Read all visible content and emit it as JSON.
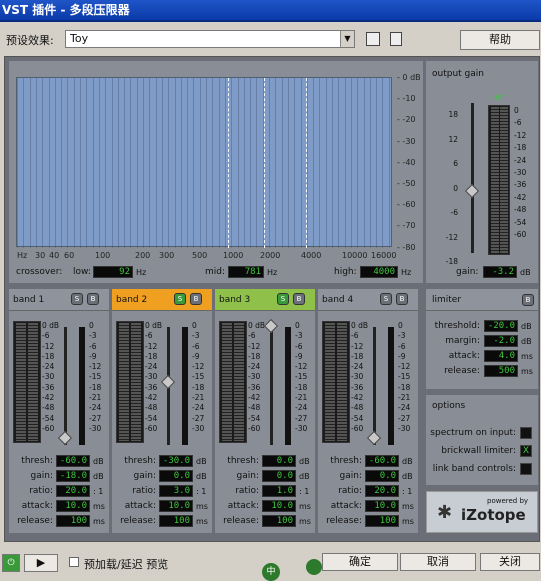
{
  "window": {
    "title": "VST 插件 - 多段压限器"
  },
  "toolbar": {
    "preset_label": "预设效果:",
    "preset_value": "Toy",
    "help_label": "帮助"
  },
  "graph": {
    "db_labels": [
      "0 dB",
      "-10",
      "-20",
      "-30",
      "-40",
      "-50",
      "-60",
      "-70",
      "-80"
    ],
    "hz_labels": [
      "Hz",
      "30",
      "40",
      "60",
      "100",
      "200",
      "300",
      "500",
      "1000",
      "2000",
      "4000",
      "10000",
      "16000"
    ],
    "crossover_label": "crossover:",
    "low_label": "low:",
    "low_value": "92",
    "mid_label": "mid:",
    "mid_value": "781",
    "high_label": "high:",
    "high_value": "4000",
    "unit": "Hz"
  },
  "output_gain": {
    "title": "output gain",
    "scale_left": [
      "18",
      "12",
      "6",
      "0",
      "-6",
      "-12",
      "-18"
    ],
    "peak": "-Inf",
    "scale_right": [
      "0",
      "-6",
      "-12",
      "-18",
      "-24",
      "-30",
      "-36",
      "-42",
      "-48",
      "-54",
      "-60"
    ],
    "gain_label": "gain:",
    "gain_value": "-3.2",
    "unit": "dB",
    "fader_level_db": -3.2
  },
  "band_meter_scale": [
    "0 dB",
    "-6",
    "-12",
    "-18",
    "-24",
    "-30",
    "-36",
    "-42",
    "-48",
    "-54",
    "-60"
  ],
  "band_gr_scale": [
    "0",
    "-3",
    "-6",
    "-9",
    "-12",
    "-15",
    "-18",
    "-21",
    "-24",
    "-27",
    "-30"
  ],
  "bands": [
    {
      "name": "band 1",
      "thresh": "-60.0",
      "gain": "-18.0",
      "ratio": "20.0",
      "attack": "10.0",
      "release": "100",
      "thresh_level_db": -60,
      "color": "#8e939c"
    },
    {
      "name": "band 2",
      "thresh": "-30.0",
      "gain": "0.0",
      "ratio": "3.0",
      "attack": "10.0",
      "release": "100",
      "thresh_level_db": -30,
      "color": "#f0a020"
    },
    {
      "name": "band 3",
      "thresh": "0.0",
      "gain": "0.0",
      "ratio": "1.0",
      "attack": "10.0",
      "release": "100",
      "thresh_level_db": 0,
      "color": "#8ec04a"
    },
    {
      "name": "band 4",
      "thresh": "-60.0",
      "gain": "0.0",
      "ratio": "20.0",
      "attack": "10.0",
      "release": "100",
      "thresh_level_db": -60,
      "color": "#8e939c"
    }
  ],
  "band_labels": {
    "thresh": "thresh:",
    "gain": "gain:",
    "ratio": "ratio:",
    "attack": "attack:",
    "release": "release:",
    "db": "dB",
    "ratio_unit": ": 1",
    "ms": "ms",
    "solo": "S",
    "bypass": "B"
  },
  "limiter": {
    "title": "limiter",
    "threshold_label": "threshold:",
    "threshold": "-20.0",
    "margin_label": "margin:",
    "margin": "-2.0",
    "attack_label": "attack:",
    "attack": "4.0",
    "release_label": "release:",
    "release": "500",
    "db": "dB",
    "ms": "ms"
  },
  "options": {
    "title": "options",
    "spectrum_label": "spectrum on input:",
    "brickwall_label": "brickwall limiter:",
    "brickwall_mark": "X",
    "link_label": "link band controls:"
  },
  "logo": {
    "powered": "powered by",
    "brand": "iZotope"
  },
  "bottom": {
    "preload_label": "预加载/延迟 预览",
    "ok": "确定",
    "cancel": "取消",
    "close": "关闭",
    "ime": "中"
  }
}
